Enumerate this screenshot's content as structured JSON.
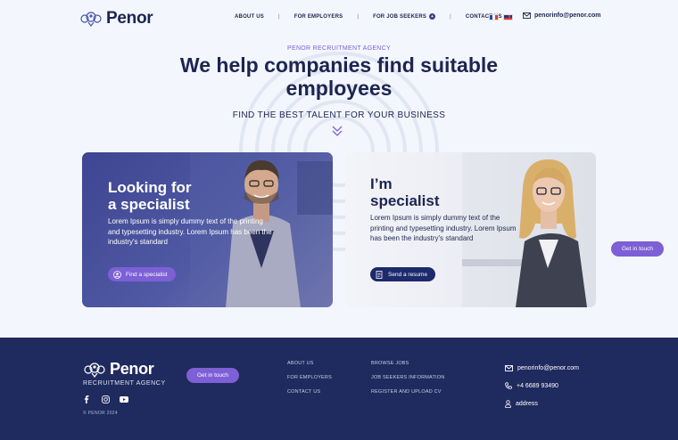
{
  "brand": {
    "name": "Penor",
    "tagline": "RECRUITMENT AGENCY"
  },
  "nav": {
    "items": [
      "ABOUT US",
      "FOR EMPLOYERS",
      "FOR JOB SEEKERS",
      "CONTACT US"
    ],
    "separator": "|",
    "job_seekers_badge": "+"
  },
  "languages": [
    "fr",
    "en"
  ],
  "contact_email": "penorinfo@penor.com",
  "hero": {
    "eyebrow": "PENOR RECRUITMENT AGENCY",
    "title": "We help companies find suitable employees",
    "subtitle": "FIND THE BEST TALENT FOR YOUR BUSINESS"
  },
  "cards": {
    "employer": {
      "title_line1": "Looking for",
      "title_line2": "a specialist",
      "text": "Lorem Ipsum is simply dummy text of the printing and typesetting industry. Lorem Ipsum has been the industry's standard",
      "button": "Find a specialist"
    },
    "seeker": {
      "title_line1": "I’m",
      "title_line2": "specialist",
      "text": "Lorem Ipsum is simply dummy text of the printing and typesetting industry. Lorem Ipsum has been the industry's standard",
      "button": "Send a resume"
    }
  },
  "get_in_touch": "Get in touch",
  "footer": {
    "col1": [
      "ABOUT US",
      "FOR EMPLOYERS",
      "CONTACT US"
    ],
    "col2": [
      "BROWSE JOBS",
      "JOB SEEKERS INFORMATION",
      "REGISTER AND UPLOAD CV"
    ],
    "email": "penorinfo@penor.com",
    "phone": "+4 6689 93490",
    "address": "address",
    "copyright": "© PENOR 2024"
  },
  "colors": {
    "navy": "#1d2550",
    "purple": "#7d5fd6",
    "footer": "#1f2a5e",
    "background": "#f3f6fd"
  }
}
